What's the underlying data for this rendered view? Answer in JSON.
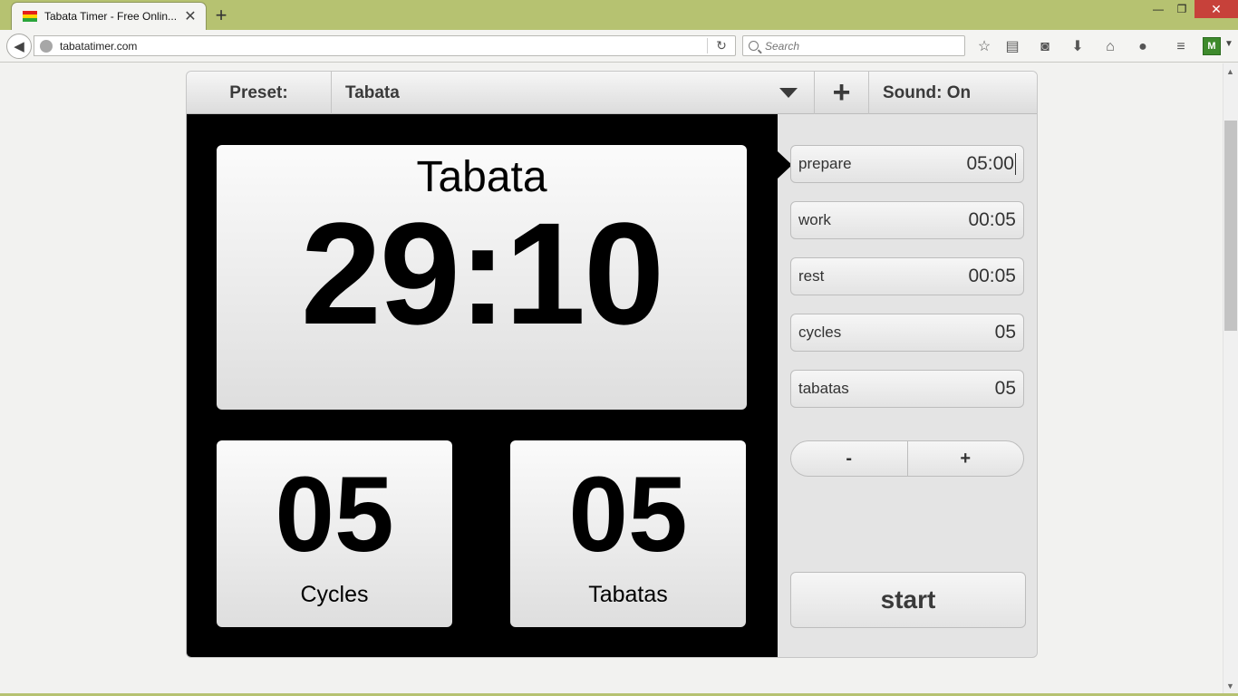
{
  "browser": {
    "tab_title": "Tabata Timer - Free Onlin...",
    "tab_close": "✕",
    "new_tab": "+",
    "window": {
      "minimize": "—",
      "restore": "❐",
      "close": "✕"
    },
    "url": "tabatatimer.com",
    "search_placeholder": "Search",
    "icons": [
      "star-icon",
      "reading-list-icon",
      "pocket-icon",
      "download-icon",
      "home-icon",
      "chat-icon",
      "menu-icon"
    ],
    "favicon_colors": [
      "#e3201b",
      "#ffd400",
      "#2aa53b"
    ]
  },
  "header": {
    "preset_label": "Preset:",
    "preset_value": "Tabata",
    "add_label": "+",
    "sound_label": "Sound: On"
  },
  "display": {
    "title": "Tabata",
    "time": "29:10",
    "cycles_value": "05",
    "cycles_label": "Cycles",
    "tabatas_value": "05",
    "tabatas_label": "Tabatas"
  },
  "settings": [
    {
      "name": "prepare",
      "value": "05:00",
      "active": true
    },
    {
      "name": "work",
      "value": "00:05",
      "active": false
    },
    {
      "name": "rest",
      "value": "00:05",
      "active": false
    },
    {
      "name": "cycles",
      "value": "05",
      "active": false
    },
    {
      "name": "tabatas",
      "value": "05",
      "active": false
    }
  ],
  "stepper": {
    "minus": "-",
    "plus": "+"
  },
  "start_label": "start"
}
